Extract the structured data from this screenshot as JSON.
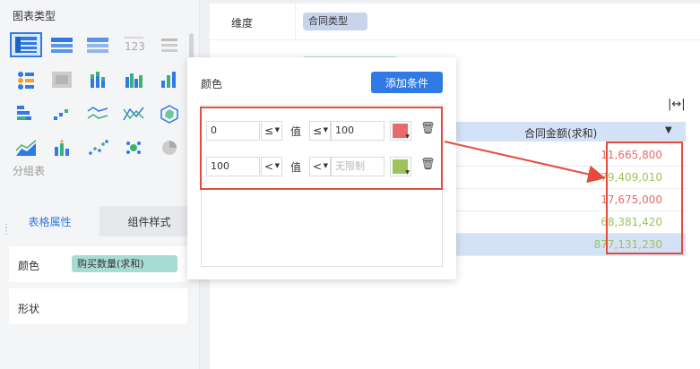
{
  "left_panel": {
    "chart_type_title": "图表类型",
    "group_label": "分组表",
    "icons": [
      "table-icon",
      "cross-table-icon",
      "detail-table-icon",
      "number-card-icon",
      "list-table-icon",
      "gantt-icon",
      "heatmap-icon",
      "stacked-bar-icon",
      "bar-icon",
      "column-icon",
      "funnel-icon",
      "step-line-icon",
      "line-icon",
      "multi-line-icon",
      "radar-icon",
      "area-icon",
      "combo-icon",
      "scatter-icon",
      "bubble-icon",
      "pie-icon"
    ],
    "tabs": {
      "table_props": "表格属性",
      "component_style": "组件样式"
    },
    "color_label": "颜色",
    "color_field": "购买数量(求和)",
    "shape_label": "形状"
  },
  "right": {
    "dimension_label": "维度",
    "dimension_field": "合同类型",
    "table_header": "合同金额(求和)",
    "values": [
      {
        "text": "11,665,800",
        "color": "#e86a6a"
      },
      {
        "text": "779,409,010",
        "color": "#9cc45a"
      },
      {
        "text": "17,675,000",
        "color": "#e86a6a"
      },
      {
        "text": "68,381,420",
        "color": "#9cc45a"
      },
      {
        "text": "877,131,230",
        "color": "#9cc45a"
      }
    ]
  },
  "popup": {
    "title": "颜色",
    "add_button": "添加条件",
    "value_label": "值",
    "conditions": [
      {
        "min": "0",
        "op1": "≤",
        "op2": "≤",
        "max": "100",
        "color": "#e86a6a"
      },
      {
        "min": "100",
        "op1": "<",
        "op2": "<",
        "max_placeholder": "无限制",
        "color": "#9cc45a"
      }
    ]
  },
  "colors": {
    "accent": "#2f7ae5",
    "highlight": "#e64b3c",
    "red": "#e86a6a",
    "green": "#9cc45a"
  }
}
